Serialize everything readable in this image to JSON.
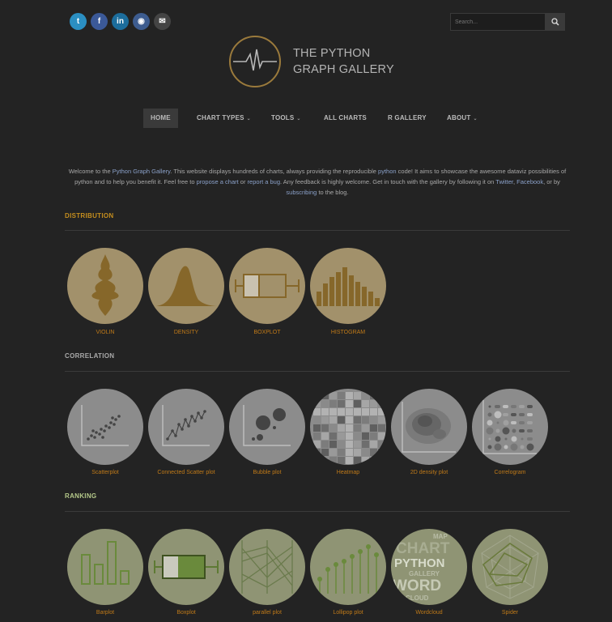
{
  "colors": {
    "accent": "#c07a18",
    "distribution": "#c58e1e",
    "ranking": "#b5c98a",
    "correlation": "#aaaaaa"
  },
  "social": [
    {
      "name": "twitter-icon",
      "glyph": "t"
    },
    {
      "name": "facebook-icon",
      "glyph": "f"
    },
    {
      "name": "linkedin-icon",
      "glyph": "in"
    },
    {
      "name": "github-icon",
      "glyph": "◉"
    },
    {
      "name": "mail-icon",
      "glyph": "✉"
    }
  ],
  "search": {
    "placeholder": "Search..."
  },
  "logo": {
    "line1": "THE PYTHON",
    "line2": "GRAPH GALLERY"
  },
  "nav": [
    {
      "label": "HOME",
      "caret": false,
      "active": true
    },
    {
      "label": "CHART TYPES",
      "caret": true,
      "active": false
    },
    {
      "label": "TOOLS",
      "caret": true,
      "active": false
    },
    {
      "label": "ALL CHARTS",
      "caret": false,
      "active": false
    },
    {
      "label": "R GALLERY",
      "caret": false,
      "active": false
    },
    {
      "label": "ABOUT",
      "caret": true,
      "active": false
    }
  ],
  "intro": {
    "t1": "Welcome to the ",
    "l1": "Python Graph Gallery",
    "t2": ". This website displays hundreds of charts, always providing the reproducible ",
    "l2": "python",
    "t3": " code! It aims to showcase the awesome dataviz possibilities of python and to help you benefit it. Feel free to ",
    "l3": "propose a chart",
    "t4": " or ",
    "l4": "report a bug",
    "t5": ". Any feedback is highly welcome. Get in touch with the gallery by following it on ",
    "l5": "Twitter",
    "t6": ", ",
    "l6": "Facebook",
    "t7": ", or by ",
    "l7": "subscribing",
    "t8": " to the blog."
  },
  "sections": [
    {
      "title": "DISTRIBUTION",
      "items": [
        "VIOLIN",
        "DENSITY",
        "BOXPLOT",
        "HISTOGRAM"
      ]
    },
    {
      "title": "CORRELATION",
      "items": [
        "Scatterplot",
        "Connected Scatter plot",
        "Bubble plot",
        "Heatmap",
        "2D density plot",
        "Correlogram"
      ]
    },
    {
      "title": "RANKING",
      "items": [
        "Barplot",
        "Boxplot",
        "parallel plot",
        "Lollipop plot",
        "Wordcloud",
        "Spider"
      ]
    }
  ],
  "wordcloud_words": [
    "MAP",
    "CHART",
    "PYTHON",
    "GALLERY",
    "WORD",
    "CLOUD"
  ]
}
